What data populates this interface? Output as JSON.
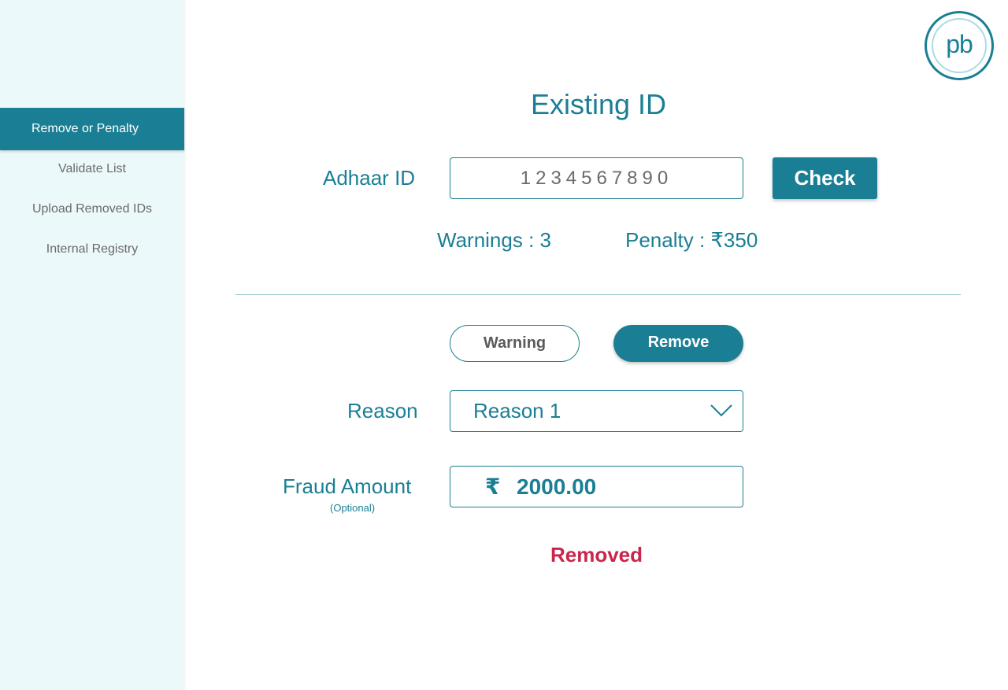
{
  "sidebar": {
    "items": [
      {
        "label": "Remove or Penalty",
        "active": true
      },
      {
        "label": "Validate List",
        "active": false
      },
      {
        "label": "Upload Removed IDs",
        "active": false
      },
      {
        "label": "Internal Registry",
        "active": false
      }
    ]
  },
  "logo": {
    "text": "pb"
  },
  "page": {
    "title": "Existing ID"
  },
  "aadhaar": {
    "label": "Adhaar ID",
    "value": "1234567890",
    "check_label": "Check"
  },
  "summary": {
    "warnings": "Warnings : 3",
    "penalty": "Penalty : ₹350"
  },
  "action": {
    "warning_label": "Warning",
    "remove_label": "Remove",
    "selected": "Remove"
  },
  "reason": {
    "label": "Reason",
    "selected": "Reason 1"
  },
  "fraud": {
    "label": "Fraud Amount",
    "sublabel": "(Optional)",
    "currency": "₹",
    "value": "2000.00"
  },
  "status": {
    "text": "Removed"
  },
  "colors": {
    "accent": "#1a7f94",
    "sidebar_bg": "#ecf9fa",
    "status": "#c8264b"
  }
}
